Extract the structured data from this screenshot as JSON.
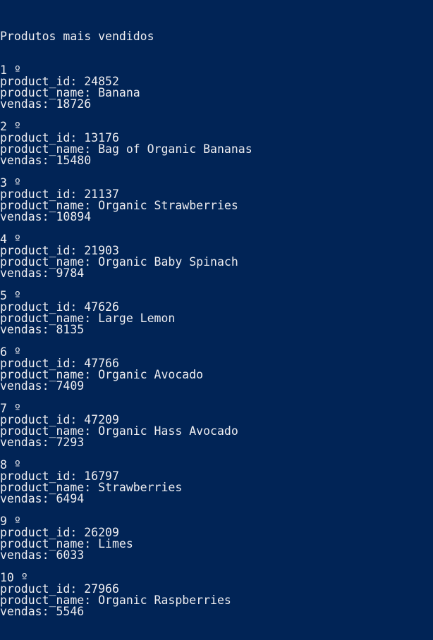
{
  "console": {
    "header": "Produtos mais vendidos",
    "product_id_label": "product_id:",
    "product_name_label": "product_name:",
    "sales_label": "vendas:",
    "entries": [
      {
        "rank": "1 º",
        "product_id": "24852",
        "product_name": "Banana",
        "vendas": "18726"
      },
      {
        "rank": "2 º",
        "product_id": "13176",
        "product_name": "Bag of Organic Bananas",
        "vendas": "15480"
      },
      {
        "rank": "3 º",
        "product_id": "21137",
        "product_name": "Organic Strawberries",
        "vendas": "10894"
      },
      {
        "rank": "4 º",
        "product_id": "21903",
        "product_name": "Organic Baby Spinach",
        "vendas": "9784"
      },
      {
        "rank": "5 º",
        "product_id": "47626",
        "product_name": "Large Lemon",
        "vendas": "8135"
      },
      {
        "rank": "6 º",
        "product_id": "47766",
        "product_name": "Organic Avocado",
        "vendas": "7409"
      },
      {
        "rank": "7 º",
        "product_id": "47209",
        "product_name": "Organic Hass Avocado",
        "vendas": "7293"
      },
      {
        "rank": "8 º",
        "product_id": "16797",
        "product_name": "Strawberries",
        "vendas": "6494"
      },
      {
        "rank": "9 º",
        "product_id": "26209",
        "product_name": "Limes",
        "vendas": "6033"
      },
      {
        "rank": "10 º",
        "product_id": "27966",
        "product_name": "Organic Raspberries",
        "vendas": "5546"
      }
    ]
  }
}
